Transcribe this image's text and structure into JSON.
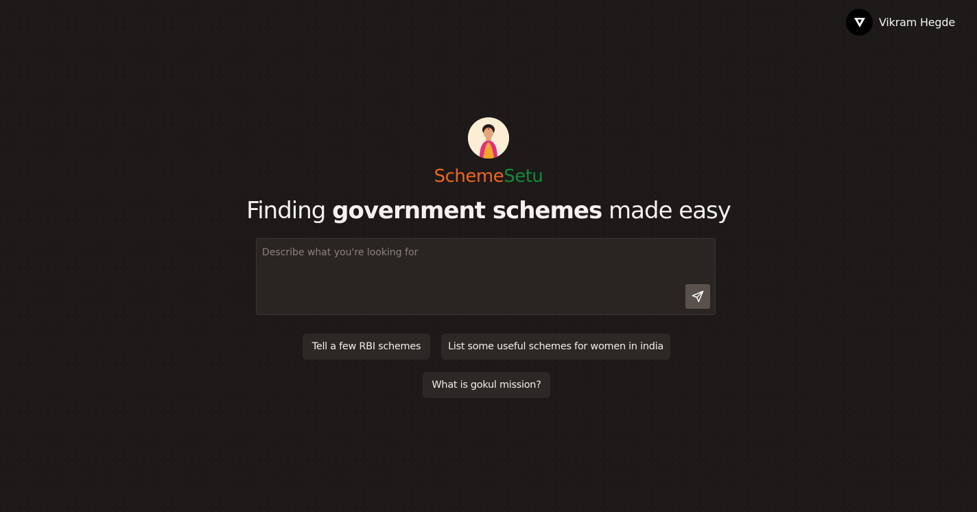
{
  "user": {
    "name": "Vikram Hegde",
    "avatar_icon": "v-logo-icon"
  },
  "brand": {
    "name_part1": "Scheme",
    "name_part2": "Setu",
    "color_part1": "#f0641f",
    "color_part2": "#138a3a"
  },
  "headline": {
    "prefix": "Finding ",
    "bold": "government schemes",
    "suffix": " made easy"
  },
  "search": {
    "placeholder": "Describe what you're looking for",
    "value": "",
    "send_icon": "send-icon"
  },
  "suggestions": [
    "Tell a few RBI schemes",
    "List some useful schemes for women in india",
    "What is gokul mission?"
  ]
}
